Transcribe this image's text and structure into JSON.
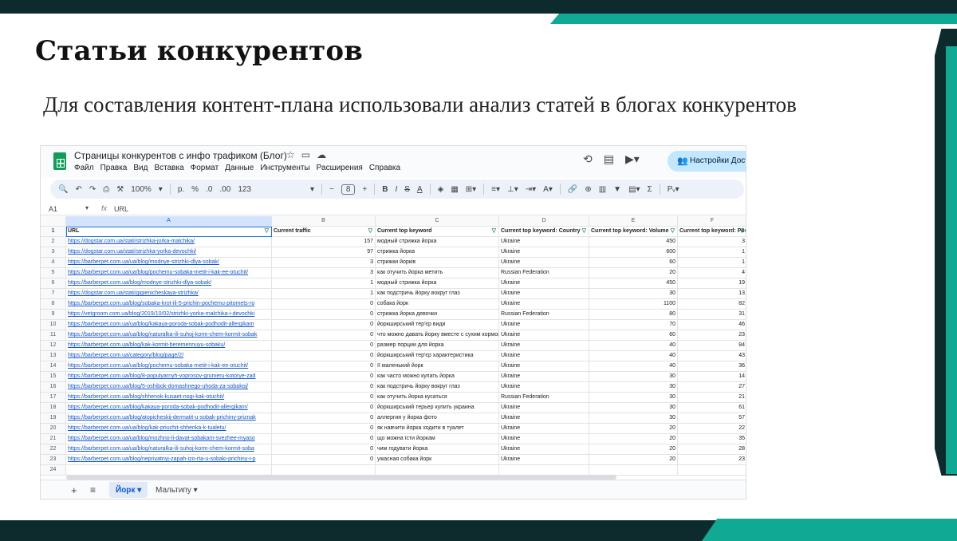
{
  "slide": {
    "title": "Статьи конкурентов",
    "subtitle": "Для составления контент-плана использовали анализ статей в блогах конкурентов"
  },
  "spreadsheet": {
    "title": "Страницы конкурентов с инфо трафиком (Блог)",
    "menu": [
      "Файл",
      "Правка",
      "Вид",
      "Вставка",
      "Формат",
      "Данные",
      "Инструменты",
      "Расширения",
      "Справка"
    ],
    "share_label": "Настройки Дост",
    "toolbar": {
      "zoom": "100%",
      "currency": "р.",
      "percent": "%",
      "decimals_less": ".0",
      "decimals_more": ".00",
      "format_more": "123",
      "font_size": "8"
    },
    "cell_ref": "A1",
    "formula_value": "URL",
    "column_letters": [
      "A",
      "B",
      "C",
      "D",
      "E",
      "F"
    ],
    "headers": [
      "URL",
      "Current traffic",
      "Current top keyword",
      "Current top keyword: Country",
      "Current top keyword: Volume",
      "Current top keyword: Position"
    ],
    "rows": [
      [
        "https://dogstar.com.ua/stati/strizhka-jorka-malchika/",
        "157",
        "модный стрижка йорка",
        "Ukraine",
        "450",
        "3"
      ],
      [
        "https://dogstar.com.ua/stati/strizhka-yorka-devochki/",
        "97",
        "стрижка йорка",
        "Ukraine",
        "600",
        "1"
      ],
      [
        "https://barberpet.com.ua/ua/blog/modnye-strizhki-dlya-sobak/",
        "3",
        "стрижки йорків",
        "Ukraine",
        "60",
        "1"
      ],
      [
        "https://barberpet.com.ua/ua/blog/pochemu-sobaka-metit-i-kak-ee-otuchit/",
        "3",
        "как отучить йорка метить",
        "Russian Federation",
        "20",
        "4"
      ],
      [
        "https://barberpet.com.ua/blog/modnye-strizhki-dlya-sobak/",
        "1",
        "модный стрижка йорка",
        "Ukraine",
        "450",
        "19"
      ],
      [
        "https://dogstar.com.ua/stati/gigienicheskaya-strizhka/",
        "1",
        "как подстричь йорку вокруг глаз",
        "Ukraine",
        "30",
        "13"
      ],
      [
        "https://barberpet.com.ua/blog/sobaka-krot-ili-5-prichin-pochemu-pitomets-ro",
        "0",
        "собака йорк",
        "Ukraine",
        "1100",
        "82"
      ],
      [
        "https://vetgroom.com.ua/blog/2019/10/02/strizhki-yorka-malchika-i-devochki",
        "0",
        "стрижка йорка девочки",
        "Russian Federation",
        "80",
        "31"
      ],
      [
        "https://barberpet.com.ua/ua/blog/kakaya-poroda-sobak-podhodit-allergikam",
        "0",
        "йоркширський тер'єр види",
        "Ukraine",
        "70",
        "46"
      ],
      [
        "https://barberpet.com.ua/ua/blog/naturalka-ili-suhoj-korm-chem-kormit-sobak",
        "0",
        "что можно давать йорку вместе с сухим кормом",
        "Ukraine",
        "60",
        "23"
      ],
      [
        "https://barberpet.com.ua/blog/kak-kormit-beremennuyu-sobaku/",
        "0",
        "размер порции для йорка",
        "Ukraine",
        "40",
        "84"
      ],
      [
        "https://barberpet.com.ua/category/blog/page/2/",
        "0",
        "йоркширський тер'єр характеристика",
        "Ukraine",
        "40",
        "43"
      ],
      [
        "https://barberpet.com.ua/ua/blog/pochemu-sobaka-metit-i-kak-ee-otuchit/",
        "0",
        "її маленький йорк",
        "Ukraine",
        "40",
        "36"
      ],
      [
        "https://barberpet.com.ua/blog/8-populyarnyh-voprosov-grumeru-kotorye-zad",
        "0",
        "как часто можно купать йорка",
        "Ukraine",
        "30",
        "14"
      ],
      [
        "https://barberpet.com.ua/blog/5-oshibok-domashnego-uhoda-za-sobakoj/",
        "0",
        "как подстричь йорку вокруг глаз",
        "Ukraine",
        "30",
        "27"
      ],
      [
        "https://barberpet.com.ua/blog/shhenok-kusaet-nogi-kak-otuchit/",
        "0",
        "как отучить йорка кусаться",
        "Russian Federation",
        "30",
        "21"
      ],
      [
        "https://barberpet.com.ua/blog/kakaya-poroda-sobak-podhodit-allergikam/",
        "0",
        "йоркширський терьер купить украина",
        "Ukraine",
        "30",
        "61"
      ],
      [
        "https://barberpet.com.ua/blog/atopicheskij-dermatit-u-sobak-prichiny-priznak",
        "0",
        "аллергия у йорка фото",
        "Ukraine",
        "30",
        "57"
      ],
      [
        "https://barberpet.com.ua/ua/blog/kak-priuchit-shhenka-k-tualetu/",
        "0",
        "як навчити йорка ходити в туалет",
        "Ukraine",
        "20",
        "22"
      ],
      [
        "https://barberpet.com.ua/ua/blog/mozhno-li-davat-sobakam-svezhee-myaso",
        "0",
        "що можна їсти йоркам",
        "Ukraine",
        "20",
        "35"
      ],
      [
        "https://barberpet.com.ua/ua/blog/naturalka-ili-suhoj-korm-chem-kormit-soba",
        "0",
        "чим годувати йорка",
        "Ukraine",
        "20",
        "28"
      ],
      [
        "https://barberpet.com.ua/blog/nepriyatnyj-zapah-izo-rta-u-sobaki-prichiny-i-p",
        "0",
        "ужасная собака йорк",
        "Ukraine",
        "20",
        "23"
      ]
    ],
    "tabs": [
      "Йорк",
      "Мальтипу"
    ]
  }
}
